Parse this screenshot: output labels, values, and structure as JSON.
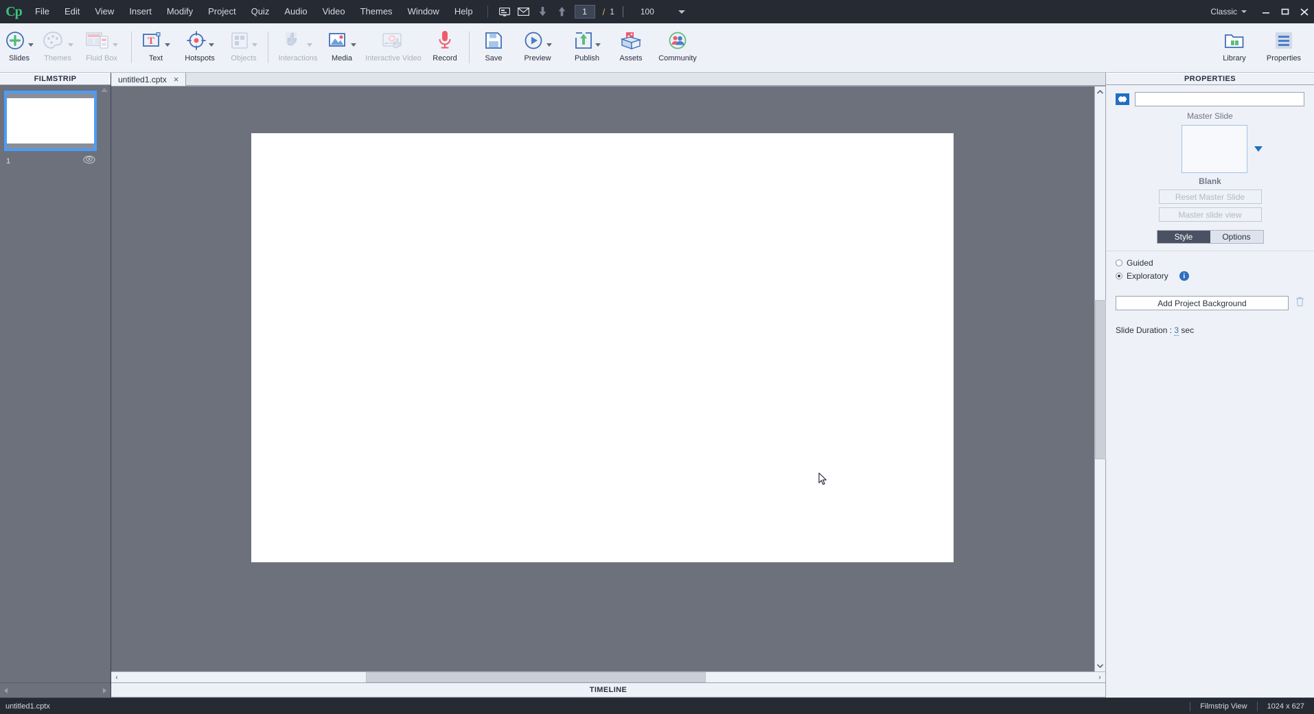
{
  "app": {
    "logo": "Cp",
    "workspace": "Classic"
  },
  "menu": {
    "items": [
      "File",
      "Edit",
      "View",
      "Insert",
      "Modify",
      "Project",
      "Quiz",
      "Audio",
      "Video",
      "Themes",
      "Window",
      "Help"
    ]
  },
  "menubar_tools": {
    "icons": [
      "presenter-icon",
      "mail-icon",
      "arrow-down-icon",
      "arrow-up-icon"
    ],
    "slide_current": "1",
    "slide_separator": "/",
    "slide_total": "1",
    "zoom": "100"
  },
  "window_controls": {
    "minimize": "minimize-icon",
    "maximize": "maximize-icon",
    "close": "close-icon"
  },
  "ribbon": {
    "groups": [
      {
        "tools": [
          {
            "label": "Slides",
            "icon": "plus-circle-icon",
            "dropdown": true,
            "disabled": false
          },
          {
            "label": "Themes",
            "icon": "palette-icon",
            "dropdown": true,
            "disabled": true
          },
          {
            "label": "Fluid Box",
            "icon": "fluid-box-icon",
            "dropdown": true,
            "disabled": true
          }
        ]
      },
      {
        "tools": [
          {
            "label": "Text",
            "icon": "text-icon",
            "dropdown": true,
            "disabled": false
          },
          {
            "label": "Hotspots",
            "icon": "hotspot-target-icon",
            "dropdown": true,
            "disabled": false
          },
          {
            "label": "Objects",
            "icon": "objects-grid-icon",
            "dropdown": true,
            "disabled": true
          }
        ]
      },
      {
        "tools": [
          {
            "label": "Interactions",
            "icon": "hand-pointer-icon",
            "dropdown": true,
            "disabled": true
          },
          {
            "label": "Media",
            "icon": "image-icon",
            "dropdown": true,
            "disabled": false
          },
          {
            "label": "Interactive Video",
            "icon": "interactive-video-icon",
            "dropdown": false,
            "disabled": true
          },
          {
            "label": "Record",
            "icon": "microphone-icon",
            "dropdown": false,
            "disabled": false
          }
        ]
      },
      {
        "tools": [
          {
            "label": "Save",
            "icon": "floppy-disk-icon",
            "dropdown": false,
            "disabled": false
          },
          {
            "label": "Preview",
            "icon": "play-circle-icon",
            "dropdown": true,
            "disabled": false
          },
          {
            "label": "Publish",
            "icon": "publish-upload-icon",
            "dropdown": true,
            "disabled": false
          },
          {
            "label": "Assets",
            "icon": "assets-box-icon",
            "dropdown": false,
            "disabled": false
          },
          {
            "label": "Community",
            "icon": "community-people-icon",
            "dropdown": false,
            "disabled": false
          }
        ]
      }
    ],
    "right_tools": [
      {
        "label": "Library",
        "icon": "library-folder-icon"
      },
      {
        "label": "Properties",
        "icon": "properties-lines-icon"
      }
    ]
  },
  "filmstrip": {
    "title": "FILMSTRIP",
    "slides": [
      {
        "number": "1",
        "badge": "slide-eye-icon"
      }
    ]
  },
  "tabs": [
    {
      "label": "untitled1.cptx",
      "close": "×",
      "active": true
    }
  ],
  "stage": {
    "cursor": "mouse-pointer-icon"
  },
  "timeline": {
    "title": "TIMELINE"
  },
  "properties": {
    "title": "PROPERTIES",
    "slide_name": "",
    "slide_name_placeholder": "",
    "master_slide_label": "Master Slide",
    "master_slide_name": "Blank",
    "reset_master_slide": "Reset Master Slide",
    "master_slide_view": "Master slide view",
    "tabs": {
      "style": "Style",
      "options": "Options",
      "selected": "Style"
    },
    "navigation": {
      "guided": "Guided",
      "exploratory": "Exploratory",
      "selected": "Exploratory",
      "info_icon": "info-icon"
    },
    "add_background_button": "Add Project Background",
    "delete_background_icon": "trash-icon",
    "slide_duration_label": "Slide Duration :",
    "slide_duration_value": "3",
    "slide_duration_unit": "sec"
  },
  "statusbar": {
    "file": "untitled1.cptx",
    "view_mode": "Filmstrip View",
    "dimensions": "1024 x 627"
  },
  "colors": {
    "accent_blue": "#4b9cf7",
    "menu_bg": "#252a33",
    "ribbon_bg": "#eef1f7",
    "stage_bg": "#6d717c",
    "logo_green": "#3ec27f",
    "record_red": "#f0576d"
  }
}
